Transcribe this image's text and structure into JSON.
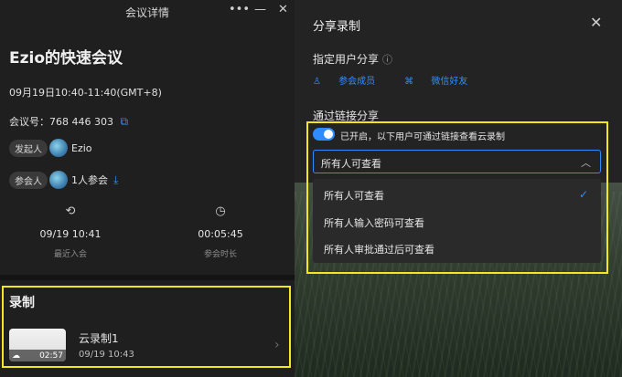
{
  "window": {
    "title": "会议详情",
    "more": "•••",
    "minimize": "—",
    "close": "✕"
  },
  "meeting": {
    "title": "Ezio的快速会议",
    "time": "09月19日10:40-11:40(GMT+8)",
    "id_label": "会议号：",
    "id_value": "768 446 303",
    "host_tag": "发起人",
    "host_name": "Ezio",
    "participants_tag": "参会人",
    "participants_count": "1人参会"
  },
  "stats": {
    "recent_join_value": "09/19 10:41",
    "recent_join_label": "最近入会",
    "duration_value": "00:05:45",
    "duration_label": "参会时长"
  },
  "recording": {
    "section_title": "录制",
    "name": "云录制1",
    "date": "09/19 10:43",
    "duration": "02:57"
  },
  "share": {
    "title": "分享录制",
    "close": "✕",
    "specific_users_label": "指定用户分享",
    "option_members": "参会成员",
    "option_wechat": "微信好友",
    "link_share_label": "通过链接分享",
    "toggle_text": "已开启，以下用户可通过链接查看云录制",
    "select_value": "所有人可查看",
    "options": [
      "所有人可查看",
      "所有人输入密码可查看",
      "所有人审批通过后可查看"
    ]
  },
  "colors": {
    "accent": "#2f8cff",
    "highlight": "#f3e61c"
  }
}
